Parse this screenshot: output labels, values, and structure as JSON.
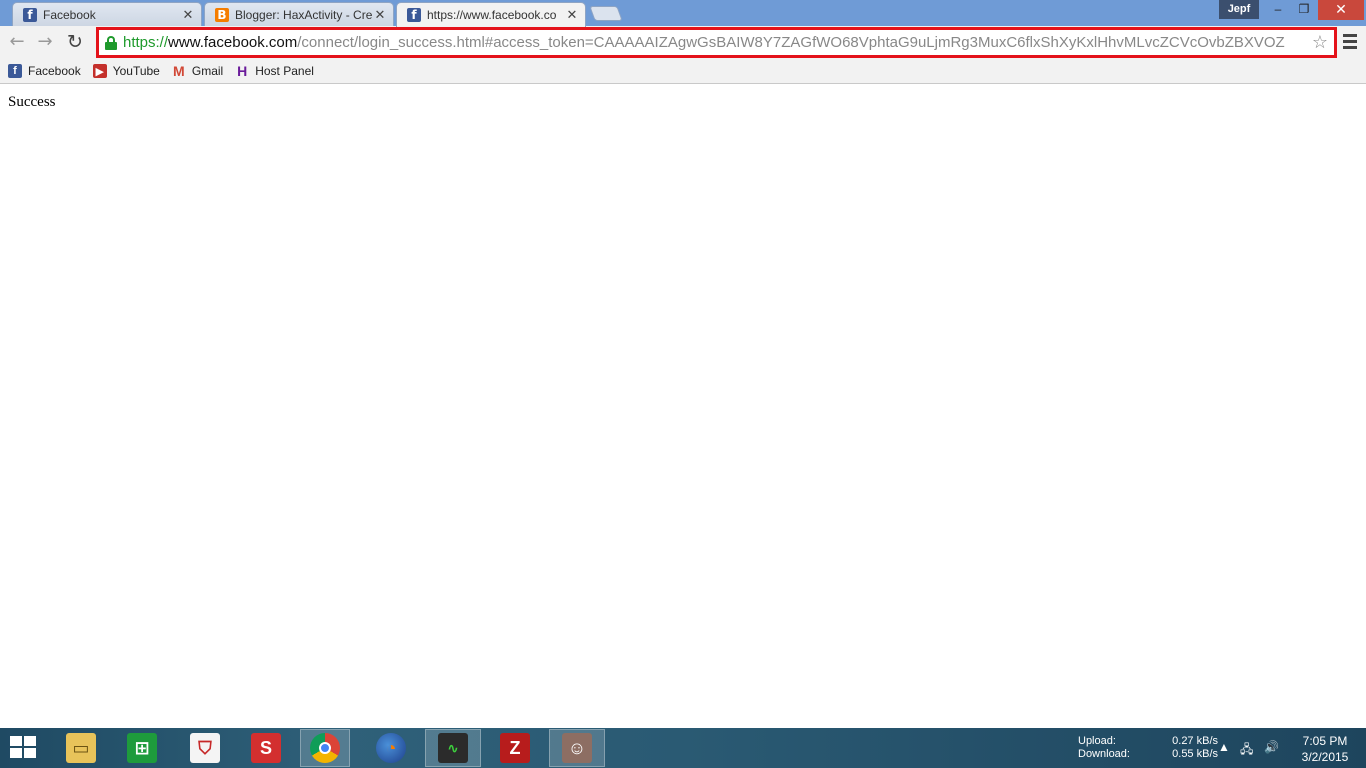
{
  "browser": {
    "tabs": [
      {
        "label": "Facebook",
        "icon": "facebook-icon"
      },
      {
        "label": "Blogger: HaxActivity - Cre",
        "icon": "blogger-icon"
      },
      {
        "label": "https://www.facebook.co",
        "icon": "facebook-icon"
      }
    ],
    "profile_name": "Jepf",
    "url": {
      "scheme": "https://",
      "host": "www.facebook.com",
      "path": "/connect/login_success.html#access_token=CAAAAAIZAgwGsBAIW8Y7ZAGfWO68VphtaG9uLjmRg3MuxC6flxShXyKxlHhvMLvcZCVcOvbZBXVOZ"
    },
    "bookmarks": [
      {
        "label": "Facebook",
        "icon": "facebook-icon"
      },
      {
        "label": "YouTube",
        "icon": "youtube-icon"
      },
      {
        "label": "Gmail",
        "icon": "gmail-icon"
      },
      {
        "label": "Host Panel",
        "icon": "host-panel-icon"
      }
    ],
    "highlight_color": "#e4121a"
  },
  "page": {
    "text": "Success"
  },
  "taskbar": {
    "apps": [
      "file-explorer-icon",
      "store-icon",
      "popcorn-icon",
      "s-app-icon",
      "chrome-icon",
      "firefox-icon",
      "monitor-icon",
      "filezilla-icon",
      "game-icon"
    ],
    "upload_label": "Upload:",
    "upload_value": "0.27 kB/s",
    "download_label": "Download:",
    "download_value": "0.55 kB/s",
    "time": "7:05 PM",
    "date": "3/2/2015"
  }
}
